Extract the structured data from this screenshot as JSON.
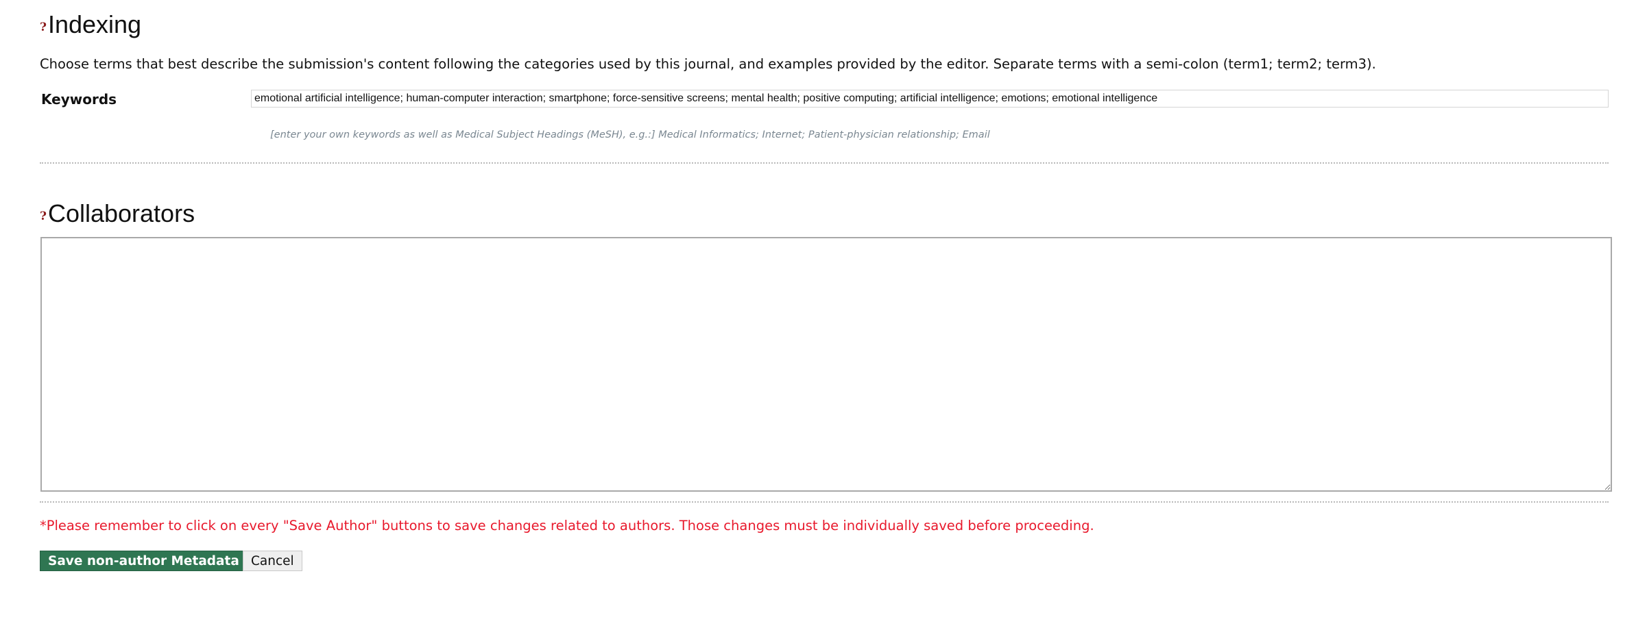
{
  "indexing": {
    "help_icon": "?",
    "title": "Indexing",
    "description": "Choose terms that best describe the submission's content following the categories used by this journal, and examples provided by the editor. Separate terms with a semi-colon (term1; term2; term3).",
    "keywords_label": "Keywords",
    "keywords_value": "emotional artificial intelligence; human-computer interaction; smartphone; force-sensitive screens; mental health; positive computing; artificial intelligence; emotions; emotional intelligence",
    "keywords_hint": "[enter your own keywords as well as Medical Subject Headings (MeSH), e.g.:] Medical Informatics; Internet; Patient-physician relationship; Email"
  },
  "collaborators": {
    "help_icon": "?",
    "title": "Collaborators",
    "value": ""
  },
  "notice": "*Please remember to click on every \"Save Author\" buttons to save changes related to authors. Those changes must be individually saved before proceeding.",
  "actions": {
    "save_label": "Save non-author Metadata",
    "cancel_label": "Cancel"
  },
  "colors": {
    "save_button_bg": "#2f7652",
    "notice_text": "#e8192c",
    "help_icon": "#8b1a1a",
    "hint_text": "#7a8791"
  }
}
